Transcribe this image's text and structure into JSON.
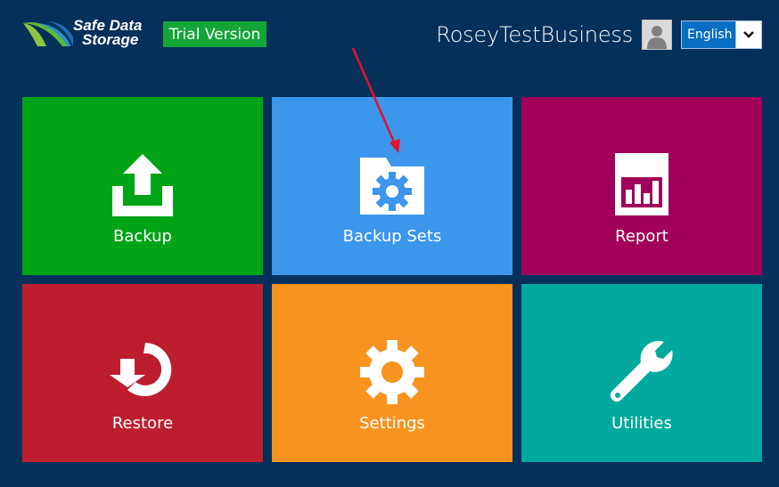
{
  "header": {
    "logo_line1": "Safe Data",
    "logo_line2": "Storage",
    "trial_badge": "Trial Version",
    "username": "RoseyTestBusiness",
    "language": {
      "selected": "English"
    }
  },
  "tiles": [
    {
      "label": "Backup",
      "color": "#00a416",
      "icon": "upload-icon"
    },
    {
      "label": "Backup Sets",
      "color": "#3b96ec",
      "icon": "folder-gear-icon"
    },
    {
      "label": "Report",
      "color": "#a0005a",
      "icon": "bar-chart-icon"
    },
    {
      "label": "Restore",
      "color": "#bd1e2e",
      "icon": "restore-icon"
    },
    {
      "label": "Settings",
      "color": "#f7931e",
      "icon": "gear-icon"
    },
    {
      "label": "Utilities",
      "color": "#00a99d",
      "icon": "wrench-icon"
    }
  ],
  "colors": {
    "background": "#05305a",
    "annotation_arrow": "#e8102a"
  }
}
